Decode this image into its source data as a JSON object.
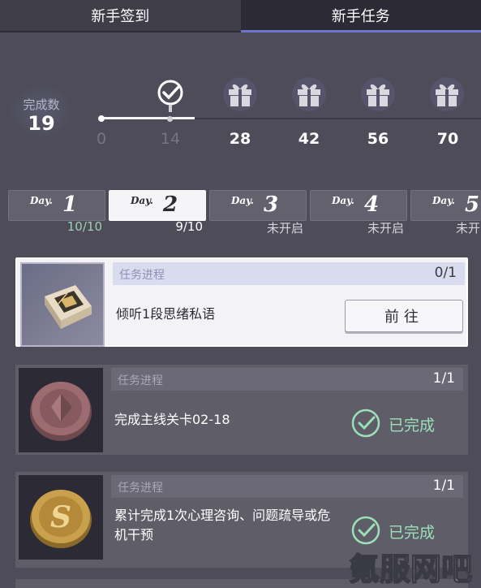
{
  "tabs": {
    "signin": "新手签到",
    "tasks": "新手任务"
  },
  "progress": {
    "count_label": "完成数",
    "count_value": "19",
    "milestones": [
      "0",
      "14",
      "28",
      "42",
      "56",
      "70"
    ]
  },
  "days": [
    {
      "word": "Day.",
      "num": "1",
      "status": "10/10"
    },
    {
      "word": "Day.",
      "num": "2",
      "status": "9/10"
    },
    {
      "word": "Day.",
      "num": "3",
      "status": "未开启"
    },
    {
      "word": "Day.",
      "num": "4",
      "status": "未开启"
    },
    {
      "word": "Day.",
      "num": "5",
      "status": "未开"
    }
  ],
  "tasks": [
    {
      "progress_label": "任务进程",
      "count": "0/1",
      "desc": "倾听1段思绪私语",
      "action": "前往"
    },
    {
      "progress_label": "任务进程",
      "count": "1/1",
      "desc": "完成主线关卡02-18",
      "action": "已完成"
    },
    {
      "progress_label": "任务进程",
      "count": "1/1",
      "desc": "累计完成1次心理咨询、问题疏导或危机干预",
      "action": "已完成"
    }
  ],
  "icons": {
    "claimed": "check-badge-icon",
    "reward": "gift-icon",
    "done": "check-circle-icon"
  },
  "colors": {
    "background": "#4d4c58",
    "tab_active_underline": "#6b76c9",
    "done_green": "#9be0b8",
    "day_complete_green": "#9bd1b0"
  },
  "watermark": "氪服网吧"
}
